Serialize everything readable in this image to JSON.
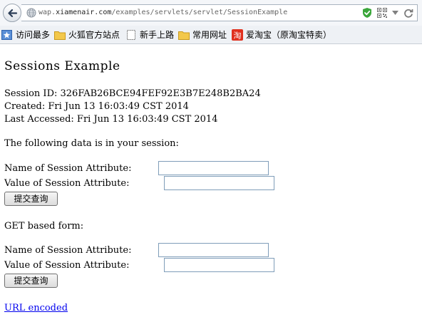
{
  "browser": {
    "url": {
      "prefix": "wap.",
      "domain": "xiamenair.com",
      "path": "/examples/servlets/servlet/SessionExample"
    },
    "bookmarks": [
      {
        "label": "访问最多",
        "icon": "bookmark-star-icon"
      },
      {
        "label": "火狐官方站点",
        "icon": "folder-icon"
      },
      {
        "label": "新手上路",
        "icon": "blank-page-icon"
      },
      {
        "label": "常用网址",
        "icon": "folder-icon"
      },
      {
        "label": "爱淘宝（原淘宝特卖）",
        "icon": "taobao-icon"
      }
    ],
    "colors": {
      "shield": "#3aa63a",
      "taobao": "#e0301e",
      "folder": "#f3c84b",
      "link": "#0000ee"
    }
  },
  "page": {
    "title": "Sessions Example",
    "session_id": "Session ID: 326FAB26BCE94FEF92E3B7E248B2BA24",
    "created": "Created: Fri Jun 13 16:03:49 CST 2014",
    "last_accessed": "Last Accessed: Fri Jun 13 16:03:49 CST 2014",
    "data_intro": "The following data is in your session:",
    "post_form": {
      "name_label": "Name of Session Attribute:",
      "value_label": "Value of Session Attribute:",
      "name_value": "",
      "value_value": "",
      "submit_label": "提交查询"
    },
    "get_form_heading": "GET based form:",
    "get_form": {
      "name_label": "Name of Session Attribute:",
      "value_label": "Value of Session Attribute:",
      "name_value": "",
      "value_value": "",
      "submit_label": "提交查询"
    },
    "url_encoded_link": "URL encoded"
  }
}
